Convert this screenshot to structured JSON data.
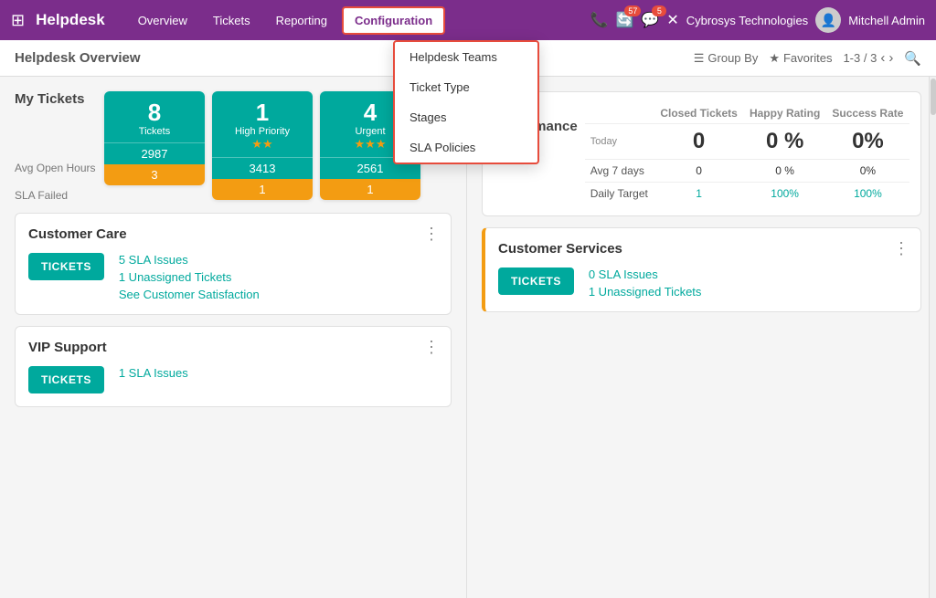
{
  "topnav": {
    "brand": "Helpdesk",
    "grid_icon": "⊞",
    "nav_items": [
      "Overview",
      "Tickets",
      "Reporting",
      "Configuration"
    ],
    "active_nav": "Configuration",
    "phone_icon": "📞",
    "chat_badge": "57",
    "msg_badge": "5",
    "close_icon": "✕",
    "company": "Cybrosys Technologies",
    "user": "Mitchell Admin"
  },
  "secondary_bar": {
    "breadcrumb": "Helpdesk Overview",
    "group_by": "Group By",
    "favorites": "Favorites",
    "pagination": "1-3 / 3"
  },
  "my_tickets": {
    "label": "My Tickets",
    "avg_open_hours": "Avg Open Hours",
    "sla_failed": "SLA Failed",
    "cards": [
      {
        "num": "8",
        "sub": "Tickets",
        "stars": "",
        "stat": "2987",
        "sla": "3"
      },
      {
        "num": "1",
        "sub": "High Priority",
        "stars": "★★",
        "stat": "3413",
        "sla": "1"
      },
      {
        "num": "4",
        "sub": "Urgent",
        "stars": "★★★",
        "stat": "2561",
        "sla": "1"
      }
    ]
  },
  "performance": {
    "title": "My Performance",
    "subtitle": "Today",
    "columns": [
      "Closed Tickets",
      "Happy Rating",
      "Success Rate"
    ],
    "today_vals": [
      "0",
      "0 %",
      "0%"
    ],
    "avg7_label": "Avg 7 days",
    "avg7_vals": [
      "0",
      "0 %",
      "0%"
    ],
    "daily_label": "Daily Target",
    "daily_vals": [
      "1",
      "100%",
      "100%"
    ]
  },
  "dropdown": {
    "items": [
      "Helpdesk Teams",
      "Ticket Type",
      "Stages",
      "SLA Policies"
    ]
  },
  "customer_care": {
    "title": "Customer Care",
    "tickets_btn": "TICKETS",
    "sla_issues": "5 SLA Issues",
    "unassigned": "1 Unassigned Tickets",
    "satisfaction": "See Customer Satisfaction"
  },
  "customer_services": {
    "title": "Customer Services",
    "tickets_btn": "TICKETS",
    "sla_issues": "0 SLA Issues",
    "unassigned": "1 Unassigned Tickets"
  },
  "vip_support": {
    "title": "VIP Support",
    "tickets_btn": "TICKETS",
    "sla_issues": "1 SLA Issues"
  }
}
